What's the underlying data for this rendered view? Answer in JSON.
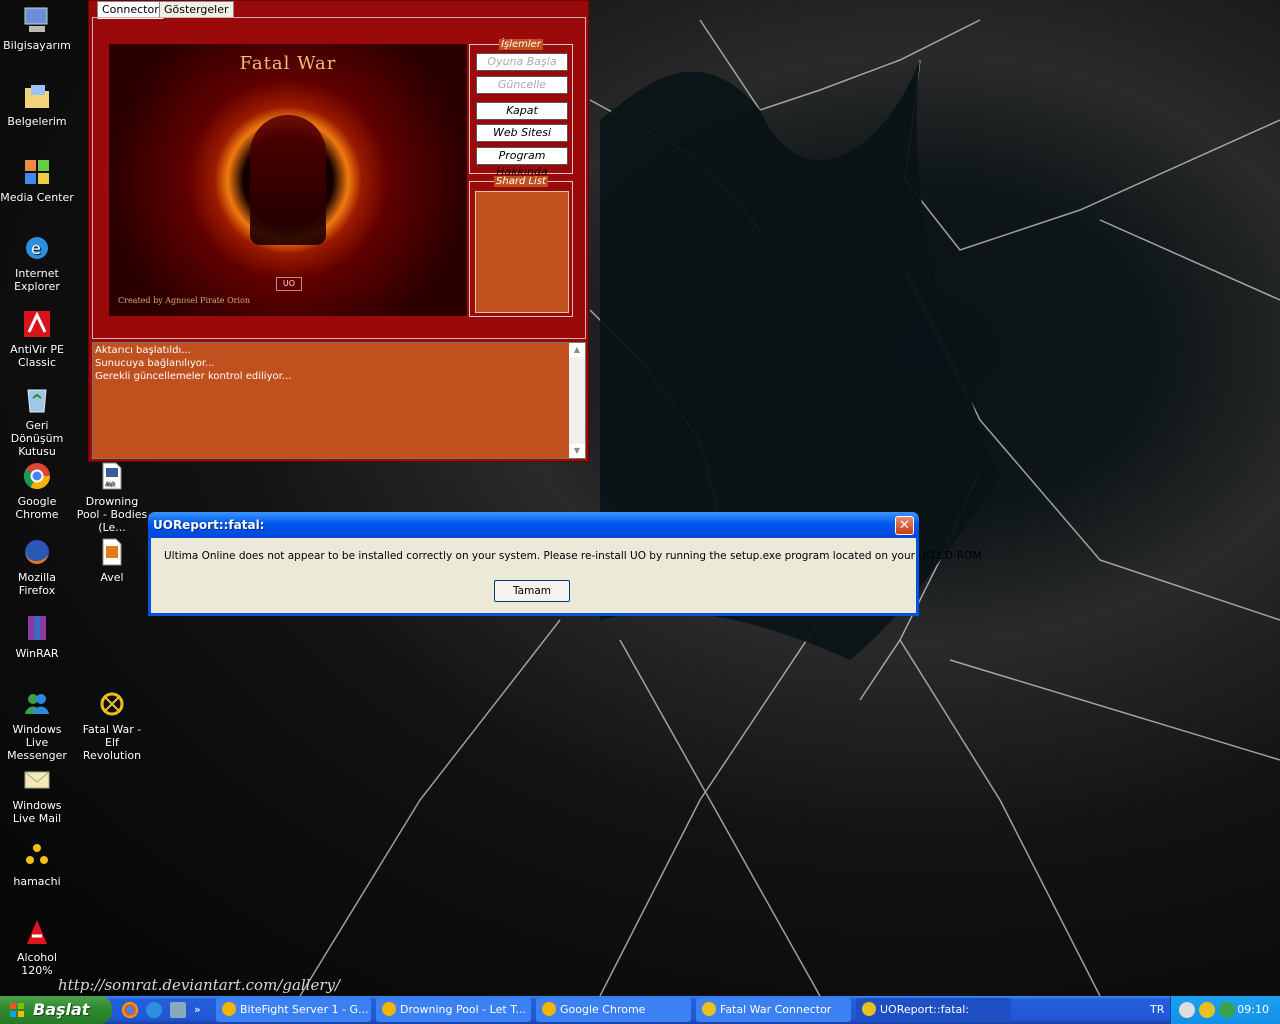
{
  "desktop": {
    "signature": "http://somrat.deviantart.com/gallery/",
    "icons": [
      {
        "label": "Bilgisayarım",
        "icon": "my-computer-icon"
      },
      {
        "label": "Belgelerim",
        "icon": "my-documents-icon"
      },
      {
        "label": "Media Center",
        "icon": "media-center-icon"
      },
      {
        "label": "Internet Explorer",
        "icon": "internet-explorer-icon"
      },
      {
        "label": "AntiVir PE Classic",
        "icon": "antivir-icon"
      },
      {
        "label": "Geri Dönüşüm Kutusu",
        "icon": "recycle-bin-icon"
      },
      {
        "label": "Google Chrome",
        "icon": "chrome-icon"
      },
      {
        "label": "Mozilla Firefox",
        "icon": "firefox-icon"
      },
      {
        "label": "WinRAR",
        "icon": "winrar-icon"
      },
      {
        "label": "Windows Live Messenger",
        "icon": "messenger-icon"
      },
      {
        "label": "Windows Live Mail",
        "icon": "live-mail-icon"
      },
      {
        "label": "hamachi",
        "icon": "hamachi-icon"
      },
      {
        "label": "Alcohol 120%",
        "icon": "alcohol-icon"
      },
      {
        "label": "Drowning Pool - Bodies (Le...",
        "icon": "avi-file-icon"
      },
      {
        "label": "Avel",
        "icon": "avel-icon"
      },
      {
        "label": "Fatal War - Elf Revolution",
        "icon": "fatal-war-icon"
      }
    ]
  },
  "connector": {
    "tabs": [
      "Connector",
      "Göstergeler"
    ],
    "banner_title": "Fatal War",
    "banner_credit": "Created by Agnosel Pirate Orion",
    "banner_uo": "UO",
    "actions_title": "İşlemler",
    "actions": [
      {
        "label": "Oyuna Başla",
        "enabled": false
      },
      {
        "label": "Güncelle",
        "enabled": false
      },
      {
        "label": "Kapat",
        "enabled": true
      },
      {
        "label": "Web Sitesi",
        "enabled": true
      },
      {
        "label": "Program Hakkında",
        "enabled": true
      }
    ],
    "shard_title": "Shard List",
    "log": [
      "Aktarıcı başlatıldı...",
      "Sunucuya bağlanılıyor...",
      "Gerekli güncellemeler kontrol ediliyor..."
    ]
  },
  "dialog": {
    "title": "UOReport::fatal:",
    "message": "Ultima Online does not appear to be installed correctly on your system. Please re-install UO by running the setup.exe program located on your UO CD-ROM",
    "ok_label": "Tamam"
  },
  "taskbar": {
    "start_label": "Başlat",
    "tasks": [
      {
        "label": "BiteFight Server 1 - G...",
        "active": false
      },
      {
        "label": "Drowning Pool - Let T...",
        "active": false
      },
      {
        "label": "Google Chrome",
        "active": false
      },
      {
        "label": "Fatal War Connector",
        "active": false
      },
      {
        "label": "UOReport::fatal:",
        "active": true
      }
    ],
    "language": "TR",
    "clock": "09:10",
    "colors": {
      "accent": "#245edb",
      "start": "#2f8a2f"
    }
  }
}
